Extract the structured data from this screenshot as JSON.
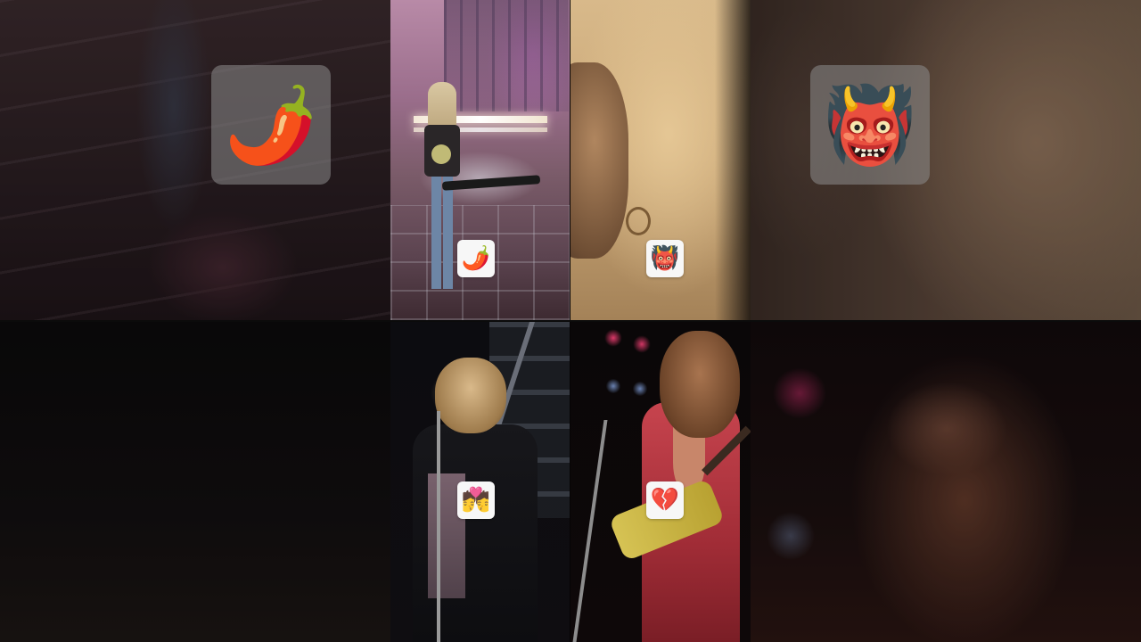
{
  "grid": {
    "tiles": [
      {
        "id": "top-left-video",
        "emoji": "🌶️",
        "emoji_name": "hot-pepper-icon"
      },
      {
        "id": "top-right-video",
        "emoji": "👹",
        "emoji_name": "ogre-icon"
      },
      {
        "id": "bottom-left-video",
        "emoji": "💏",
        "emoji_name": "kiss-icon"
      },
      {
        "id": "bottom-right-video",
        "emoji": "💔",
        "emoji_name": "broken-heart-icon"
      }
    ]
  },
  "side_badges": {
    "left": {
      "emoji": "🌶️",
      "emoji_name": "hot-pepper-icon"
    },
    "right": {
      "emoji": "👹",
      "emoji_name": "ogre-icon"
    }
  },
  "colors": {
    "badge_bg": "#f7f7f7",
    "side_badge_bg": "#8c8c8c"
  }
}
